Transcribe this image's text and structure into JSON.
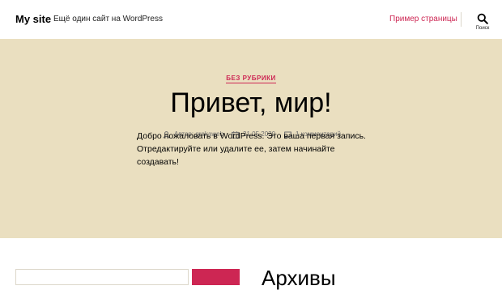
{
  "header": {
    "site_title": "My site",
    "site_description": "Ещё один сайт на WordPress",
    "nav_link": "Пример страницы",
    "search_label": "Поиск",
    "search_icon": "search-icon"
  },
  "post": {
    "category": "БЕЗ РУБРИКИ",
    "title": "Привет, мир!",
    "author": "Автор: grekaweb",
    "date": "21.05.2020",
    "comments": "1 комментарий",
    "content": "Добро пожаловать в WordPress. Это ваша первая запись. Отредактируйте или удалите ее, затем начинайте создавать!"
  },
  "widgets": {
    "archives_title": "Архивы"
  },
  "colors": {
    "accent": "#cd2653",
    "header_bg": "#eadfc0",
    "text": "#000000",
    "meta_text": "#6d6d6d"
  }
}
